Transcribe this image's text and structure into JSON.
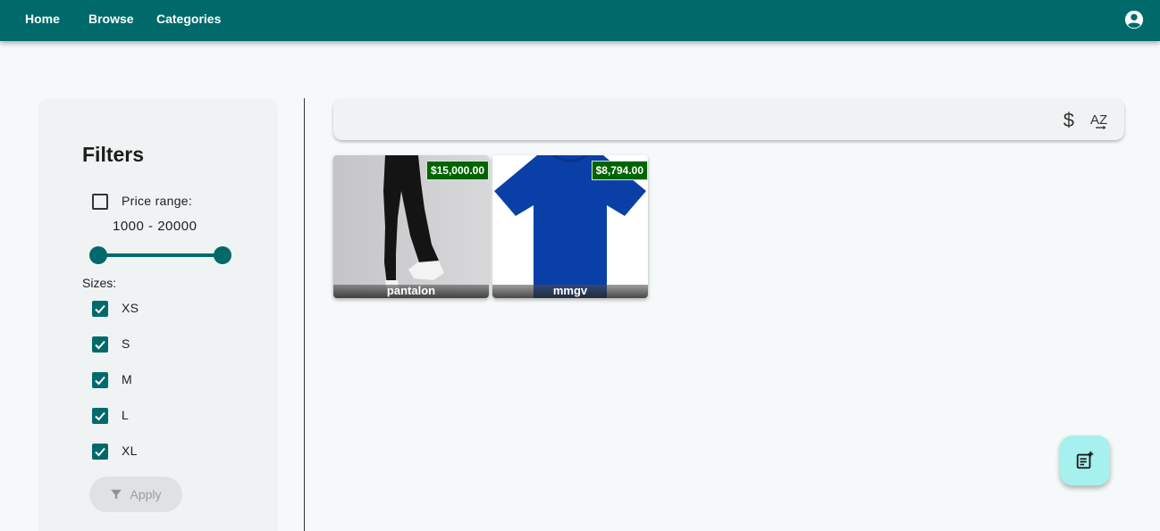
{
  "nav": {
    "links": [
      {
        "label": "Home"
      },
      {
        "label": "Browse"
      },
      {
        "label": "Categories"
      }
    ],
    "account_icon": "account-circle-icon",
    "bg_color": "#006a6a"
  },
  "filters": {
    "title": "Filters",
    "price_range": {
      "label": "Price range:",
      "enabled": false,
      "value_text": "1000 - 20000",
      "min": 1000,
      "max": 20000
    },
    "sizes": {
      "label": "Sizes:",
      "options": [
        {
          "label": "XS",
          "checked": true
        },
        {
          "label": "S",
          "checked": true
        },
        {
          "label": "M",
          "checked": true
        },
        {
          "label": "L",
          "checked": true
        },
        {
          "label": "XL",
          "checked": true
        }
      ]
    },
    "apply_label": "Apply",
    "apply_icon": "filter-icon"
  },
  "toolbar": {
    "sort_price_icon": "dollar-icon",
    "sort_alpha_icon": "sort-az-icon",
    "sort_price_glyph": "$",
    "sort_alpha_glyph": "AZ"
  },
  "products": [
    {
      "title": "pantalon",
      "price": "$15,000.00",
      "image": "black-pants-photo"
    },
    {
      "title": "mmgv",
      "price": "$8,794.00",
      "image": "blue-tshirt-photo"
    }
  ],
  "fab": {
    "icon": "add-note-icon",
    "color": "#a6f0ee"
  }
}
